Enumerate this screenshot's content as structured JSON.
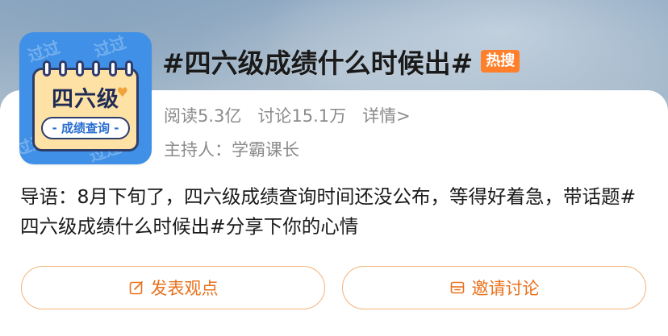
{
  "topic": {
    "title": "#四六级成绩什么时候出#",
    "hot_badge": "热搜",
    "image": {
      "watermark_text": "过过",
      "calendar_title": "四六级",
      "calendar_banner": "- 成绩查询 -"
    }
  },
  "stats": {
    "read": "阅读5.3亿",
    "discuss": "讨论15.1万",
    "details": "详情>"
  },
  "host": "主持人：学霸课长",
  "intro": "导语：8月下旬了，四六级成绩查询时间还没公布，等得好着急，带话题#四六级成绩什么时候出#分享下你的心情",
  "actions": {
    "post_label": "发表观点",
    "post_icon": "edit-icon",
    "invite_label": "邀请讨论",
    "invite_icon": "mail-icon"
  },
  "colors": {
    "accent": "#e9711c",
    "badge": "#ff7f2a",
    "button_border": "#f3b37a",
    "image_bg": "#3f90e6"
  }
}
